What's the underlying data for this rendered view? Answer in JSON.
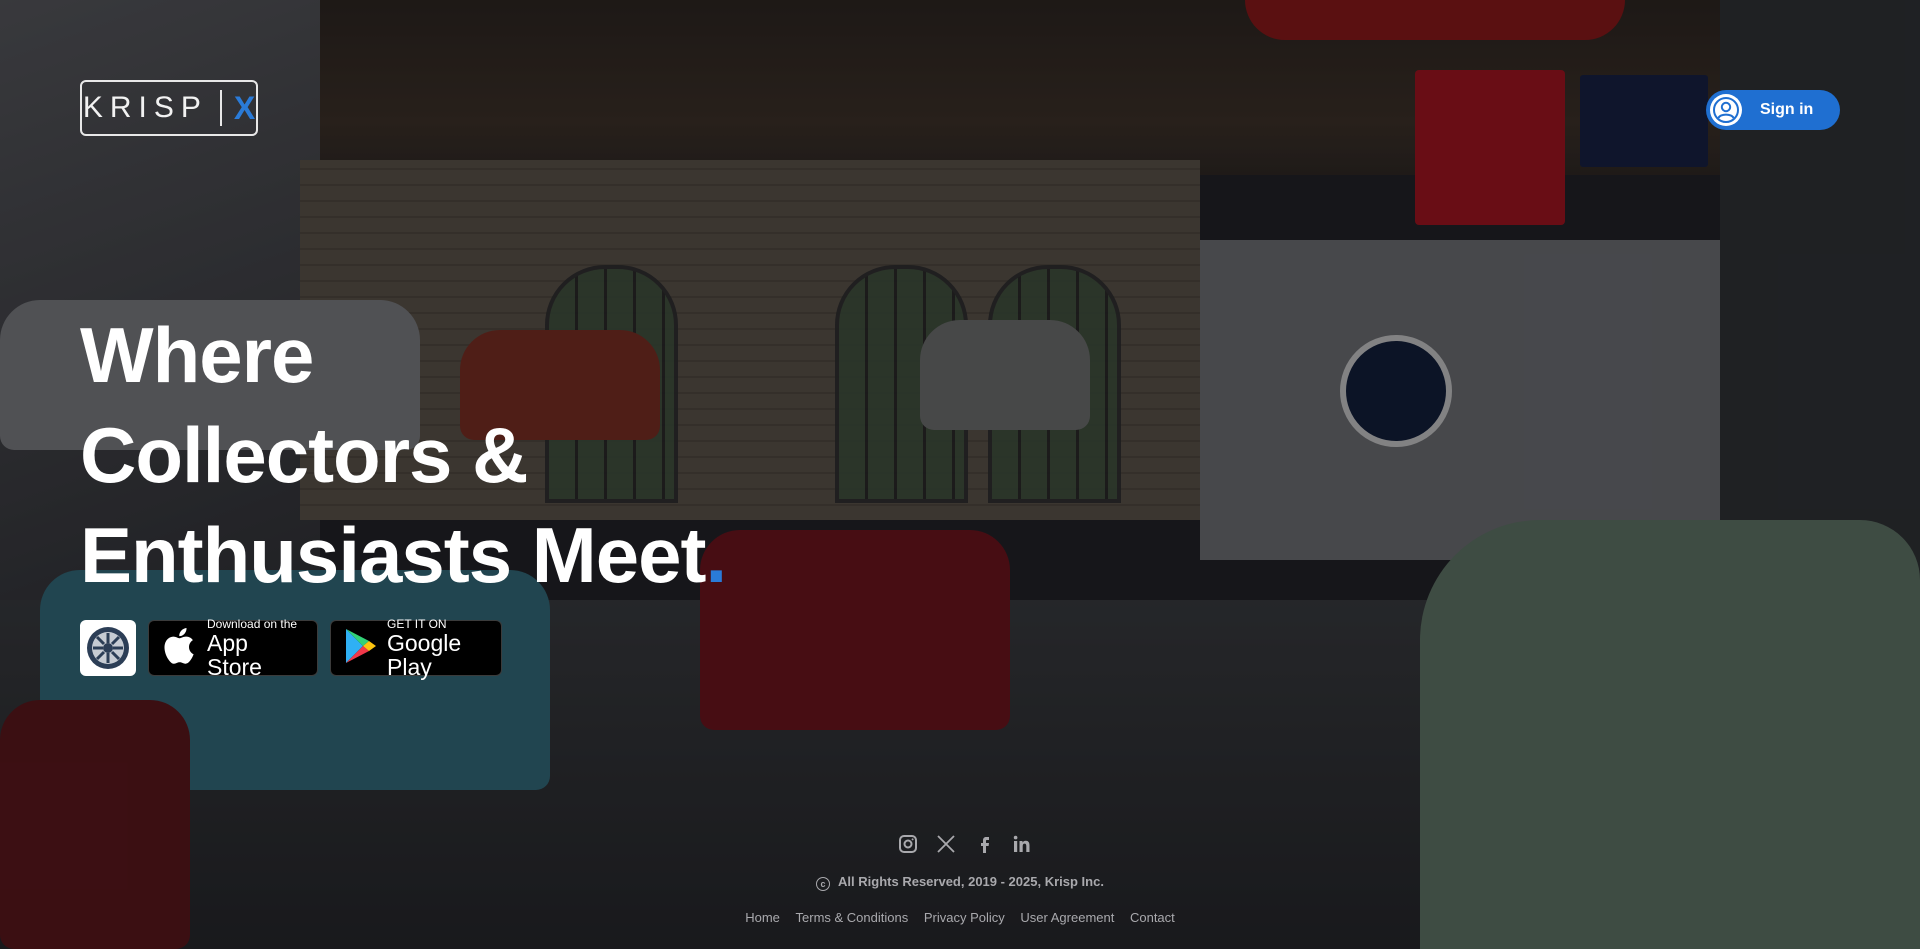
{
  "brand": {
    "name": "KRISP",
    "mark": "X"
  },
  "header": {
    "signin_label": "Sign in",
    "avatar_icon": "user-icon"
  },
  "hero": {
    "line1": "Where",
    "line2": "Collectors &",
    "line3": "Enthusiasts Meet",
    "punctuation": "."
  },
  "badges": {
    "wheel_icon": "wheel-logo-icon",
    "appstore": {
      "small": "Download on the",
      "big": "App Store",
      "icon": "apple-icon"
    },
    "googleplay": {
      "small": "GET IT ON",
      "big": "Google Play",
      "icon": "google-play-icon"
    }
  },
  "footer": {
    "social": [
      "instagram-icon",
      "x-icon",
      "facebook-icon",
      "linkedin-icon"
    ],
    "copyright": "All Rights Reserved, 2019 - 2025, Krisp Inc.",
    "links": [
      "Home",
      "Terms & Conditions",
      "Privacy Policy",
      "User Agreement",
      "Contact"
    ]
  },
  "colors": {
    "accent": "#2a7bd8",
    "signin_bg": "#1f6fd1",
    "footer_text": "#a9a9ad"
  }
}
